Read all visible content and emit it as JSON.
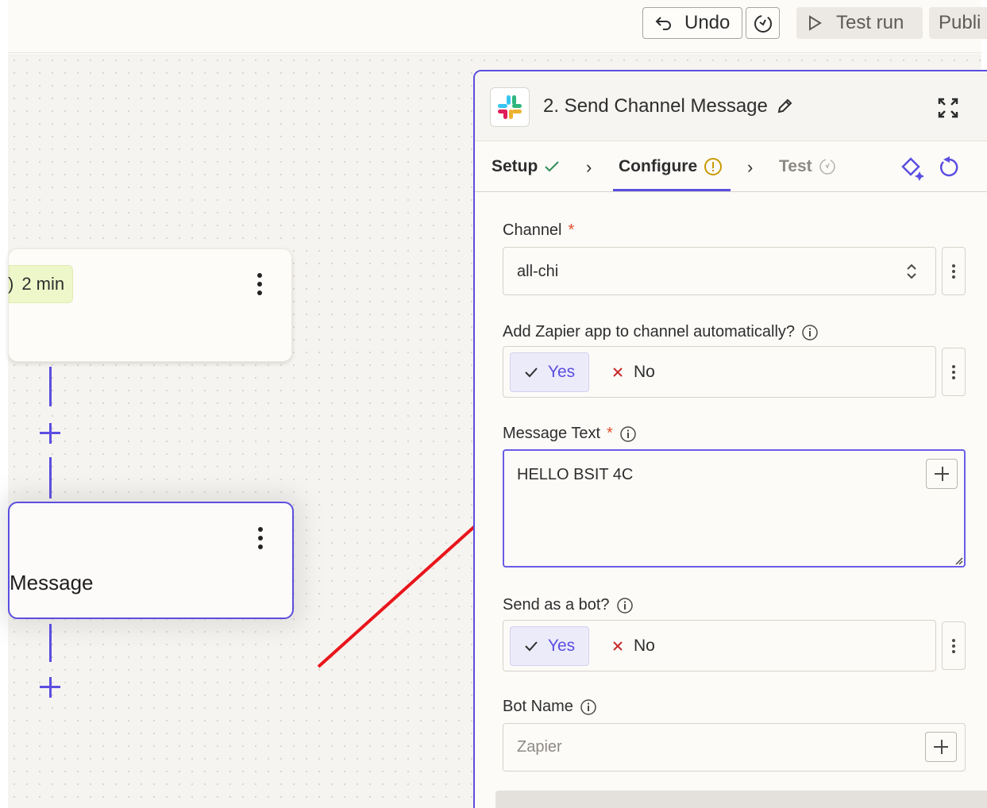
{
  "toolbar": {
    "undo_label": "Undo",
    "test_run_label": "Test run",
    "publish_label": "Publi"
  },
  "canvas": {
    "step1": {
      "delay_label": "2 min"
    },
    "step2": {
      "title": "Message"
    }
  },
  "panel": {
    "title": "2. Send Channel Message",
    "tabs": [
      {
        "label": "Setup",
        "status": "complete"
      },
      {
        "label": "Configure",
        "status": "warning"
      },
      {
        "label": "Test",
        "status": "pending"
      }
    ],
    "fields": {
      "channel": {
        "label": "Channel",
        "required_mark": "*",
        "value": "all-chi"
      },
      "add_app": {
        "label": "Add Zapier app to channel automatically?",
        "yes_label": "Yes",
        "no_label": "No",
        "selected": "Yes"
      },
      "message_text": {
        "label": "Message Text",
        "required_mark": "*",
        "value": "HELLO BSIT 4C"
      },
      "send_as_bot": {
        "label": "Send as a bot?",
        "yes_label": "Yes",
        "no_label": "No",
        "selected": "Yes"
      },
      "bot_name": {
        "label": "Bot Name",
        "placeholder": "Zapier"
      }
    }
  },
  "colors": {
    "accent": "#5b4ee0",
    "required": "#e0502b",
    "success": "#2f8c57",
    "warning": "#c99a06",
    "arrow": "#e8151b"
  }
}
